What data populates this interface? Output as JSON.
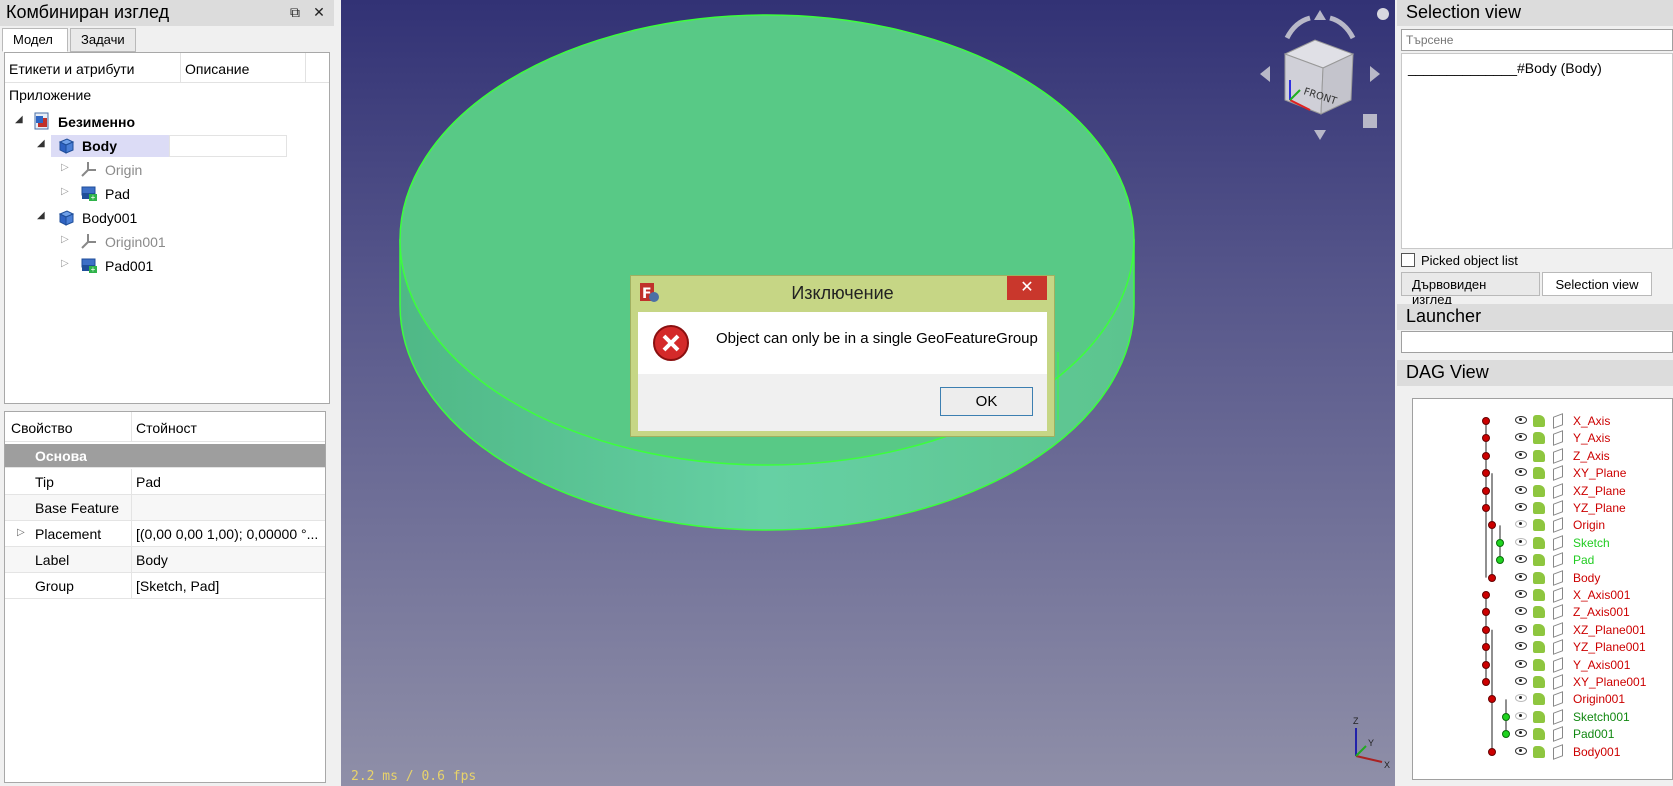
{
  "left_panel": {
    "title": "Комбиниран изглед",
    "tabs": [
      "Модел",
      "Задачи"
    ],
    "tree_headers": [
      "Етикети и атрибути",
      "Описание"
    ],
    "tree_root_label": "Приложение",
    "tree": [
      {
        "label": "Безименно",
        "bold": true
      },
      {
        "label": "Body",
        "bold": true,
        "selected": true
      },
      {
        "label": "Origin",
        "muted": true
      },
      {
        "label": "Pad"
      },
      {
        "label": "Body001"
      },
      {
        "label": "Origin001",
        "muted": true
      },
      {
        "label": "Pad001"
      }
    ],
    "props_headers": [
      "Свойство",
      "Стойност"
    ],
    "props_group": "Основа",
    "props": [
      {
        "key": "Tip",
        "value": "Pad"
      },
      {
        "key": "Base Feature",
        "value": ""
      },
      {
        "key": "Placement",
        "value": "[(0,00 0,00 1,00); 0,00000 °..."
      },
      {
        "key": "Label",
        "value": "Body"
      },
      {
        "key": "Group",
        "value": "[Sketch, Pad]"
      }
    ]
  },
  "viewport": {
    "fps": "2.2 ms / 0.6 fps",
    "navcube_label": "FRONT",
    "axis_labels": [
      "Z",
      "Y",
      "X"
    ]
  },
  "dialog": {
    "title": "Изключение",
    "close_glyph": "✕",
    "message": "Object can only be in a single GeoFeatureGroup",
    "ok_label": "OK"
  },
  "right_panel": {
    "selection_title": "Selection view",
    "search_placeholder": "Търсене",
    "selection_item": "______________#Body (Body)",
    "picked_label": "Picked object list",
    "tabs": [
      "Дървовиден изглед",
      "Selection view"
    ],
    "launcher_title": "Launcher",
    "dag_title": "DAG View",
    "dag_items": [
      {
        "label": "X_Axis",
        "color": "#cc0000",
        "dot": "r"
      },
      {
        "label": "Y_Axis",
        "color": "#cc0000",
        "dot": "r"
      },
      {
        "label": "Z_Axis",
        "color": "#cc0000",
        "dot": "r"
      },
      {
        "label": "XY_Plane",
        "color": "#cc0000",
        "dot": "r"
      },
      {
        "label": "XZ_Plane",
        "color": "#cc0000",
        "dot": "r"
      },
      {
        "label": "YZ_Plane",
        "color": "#cc0000",
        "dot": "r"
      },
      {
        "label": "Origin",
        "color": "#cc0000",
        "dot": "r"
      },
      {
        "label": "Sketch",
        "color": "#22cc22",
        "dot": "g"
      },
      {
        "label": "Pad",
        "color": "#22cc22",
        "dot": "g"
      },
      {
        "label": "Body",
        "color": "#cc0000",
        "dot": "r"
      },
      {
        "label": "X_Axis001",
        "color": "#cc0000",
        "dot": "r"
      },
      {
        "label": "Z_Axis001",
        "color": "#cc0000",
        "dot": "r"
      },
      {
        "label": "XZ_Plane001",
        "color": "#cc0000",
        "dot": "r"
      },
      {
        "label": "YZ_Plane001",
        "color": "#cc0000",
        "dot": "r"
      },
      {
        "label": "Y_Axis001",
        "color": "#cc0000",
        "dot": "r"
      },
      {
        "label": "XY_Plane001",
        "color": "#cc0000",
        "dot": "r"
      },
      {
        "label": "Origin001",
        "color": "#cc0000",
        "dot": "r"
      },
      {
        "label": "Sketch001",
        "color": "#118811",
        "dot": "g"
      },
      {
        "label": "Pad001",
        "color": "#118811",
        "dot": "g"
      },
      {
        "label": "Body001",
        "color": "#cc0000",
        "dot": "r"
      }
    ]
  }
}
